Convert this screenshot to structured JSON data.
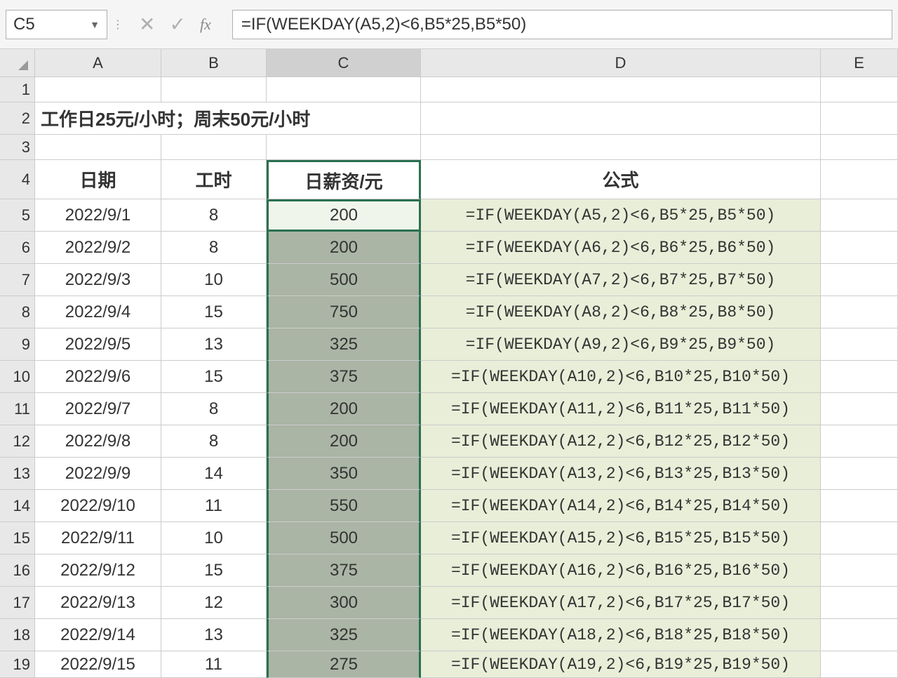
{
  "formula_bar": {
    "name_box": "C5",
    "fx_label": "fx",
    "formula": "=IF(WEEKDAY(A5,2)<6,B5*25,B5*50)"
  },
  "columns": [
    "A",
    "B",
    "C",
    "D",
    "E"
  ],
  "note_text": "工作日25元/小时；周末50元/小时",
  "headers": {
    "col_a": "日期",
    "col_b": "工时",
    "col_c": "日薪资/元",
    "col_d": "公式"
  },
  "rows": [
    {
      "num": "5",
      "date": "2022/9/1",
      "hours": "8",
      "salary": "200",
      "formula": "=IF(WEEKDAY(A5,2)<6,B5*25,B5*50)"
    },
    {
      "num": "6",
      "date": "2022/9/2",
      "hours": "8",
      "salary": "200",
      "formula": "=IF(WEEKDAY(A6,2)<6,B6*25,B6*50)"
    },
    {
      "num": "7",
      "date": "2022/9/3",
      "hours": "10",
      "salary": "500",
      "formula": "=IF(WEEKDAY(A7,2)<6,B7*25,B7*50)"
    },
    {
      "num": "8",
      "date": "2022/9/4",
      "hours": "15",
      "salary": "750",
      "formula": "=IF(WEEKDAY(A8,2)<6,B8*25,B8*50)"
    },
    {
      "num": "9",
      "date": "2022/9/5",
      "hours": "13",
      "salary": "325",
      "formula": "=IF(WEEKDAY(A9,2)<6,B9*25,B9*50)"
    },
    {
      "num": "10",
      "date": "2022/9/6",
      "hours": "15",
      "salary": "375",
      "formula": "=IF(WEEKDAY(A10,2)<6,B10*25,B10*50)"
    },
    {
      "num": "11",
      "date": "2022/9/7",
      "hours": "8",
      "salary": "200",
      "formula": "=IF(WEEKDAY(A11,2)<6,B11*25,B11*50)"
    },
    {
      "num": "12",
      "date": "2022/9/8",
      "hours": "8",
      "salary": "200",
      "formula": "=IF(WEEKDAY(A12,2)<6,B12*25,B12*50)"
    },
    {
      "num": "13",
      "date": "2022/9/9",
      "hours": "14",
      "salary": "350",
      "formula": "=IF(WEEKDAY(A13,2)<6,B13*25,B13*50)"
    },
    {
      "num": "14",
      "date": "2022/9/10",
      "hours": "11",
      "salary": "550",
      "formula": "=IF(WEEKDAY(A14,2)<6,B14*25,B14*50)"
    },
    {
      "num": "15",
      "date": "2022/9/11",
      "hours": "10",
      "salary": "500",
      "formula": "=IF(WEEKDAY(A15,2)<6,B15*25,B15*50)"
    },
    {
      "num": "16",
      "date": "2022/9/12",
      "hours": "15",
      "salary": "375",
      "formula": "=IF(WEEKDAY(A16,2)<6,B16*25,B16*50)"
    },
    {
      "num": "17",
      "date": "2022/9/13",
      "hours": "12",
      "salary": "300",
      "formula": "=IF(WEEKDAY(A17,2)<6,B17*25,B17*50)"
    },
    {
      "num": "18",
      "date": "2022/9/14",
      "hours": "13",
      "salary": "325",
      "formula": "=IF(WEEKDAY(A18,2)<6,B18*25,B18*50)"
    },
    {
      "num": "19",
      "date": "2022/9/15",
      "hours": "11",
      "salary": "275",
      "formula": "=IF(WEEKDAY(A19,2)<6,B19*25,B19*50)"
    }
  ],
  "row_labels": [
    "1",
    "2",
    "3",
    "4"
  ]
}
